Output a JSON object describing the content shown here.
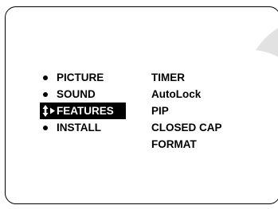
{
  "main_menu": {
    "items": [
      {
        "label": "PICTURE",
        "selected": false
      },
      {
        "label": "SOUND",
        "selected": false
      },
      {
        "label": "FEATURES",
        "selected": true
      },
      {
        "label": "INSTALL",
        "selected": false
      }
    ]
  },
  "sub_menu": {
    "items": [
      {
        "label": "TIMER"
      },
      {
        "label": "AutoLock"
      },
      {
        "label": "PIP"
      },
      {
        "label": "CLOSED CAP"
      },
      {
        "label": "FORMAT"
      }
    ]
  },
  "icons": {
    "selection_indicator": "up-down-right-arrows-icon"
  },
  "colors": {
    "background": "#ffffff",
    "text": "#000000",
    "highlight_bg": "#000000",
    "highlight_text": "#ffffff",
    "sweep": "#e2e2e2"
  }
}
